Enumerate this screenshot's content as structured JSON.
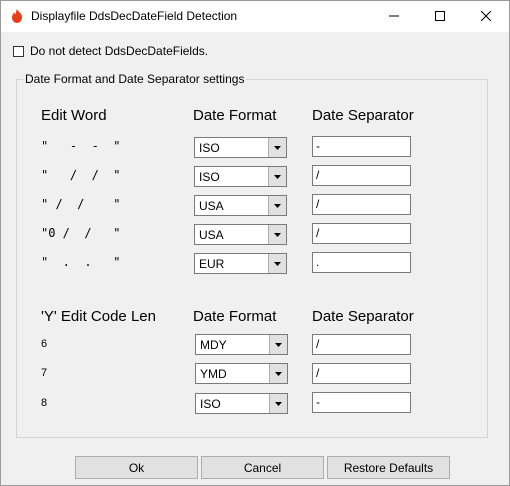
{
  "window": {
    "title": "Displayfile DdsDecDateField Detection"
  },
  "checkbox": {
    "label": "Do not detect DdsDecDateFields.",
    "checked": false
  },
  "group": {
    "legend": "Date Format and Date Separator settings",
    "edit_word_section": {
      "headers": {
        "col1": "Edit Word",
        "col2": "Date Format",
        "col3": "Date Separator"
      },
      "rows": [
        {
          "edit_word": "\"   -  -  \"",
          "format": "ISO",
          "separator": "-"
        },
        {
          "edit_word": "\"   /  /  \"",
          "format": "ISO",
          "separator": "/"
        },
        {
          "edit_word": "\" /  /    \"",
          "format": "USA",
          "separator": "/"
        },
        {
          "edit_word": "\"0 /  /   \"",
          "format": "USA",
          "separator": "/"
        },
        {
          "edit_word": "\"  .  .   \"",
          "format": "EUR",
          "separator": "."
        }
      ]
    },
    "code_section": {
      "headers": {
        "col1": "'Y' Edit Code Len",
        "col2": "Date Format",
        "col3": "Date Separator"
      },
      "rows": [
        {
          "len": "6",
          "format": "MDY",
          "separator": "/"
        },
        {
          "len": "7",
          "format": "YMD",
          "separator": "/"
        },
        {
          "len": "8",
          "format": "ISO",
          "separator": "-"
        }
      ]
    }
  },
  "buttons": {
    "ok": "Ok",
    "cancel": "Cancel",
    "restore": "Restore Defaults"
  },
  "colors": {
    "app_icon": "#e2401c",
    "title_bar": "#ffffff",
    "dialog_bg": "#f0f0f0"
  },
  "icons": {
    "app": "flame-icon",
    "minimize": "minimize-icon",
    "maximize": "maximize-icon",
    "close": "close-icon",
    "dropdown": "chevron-down-icon"
  }
}
